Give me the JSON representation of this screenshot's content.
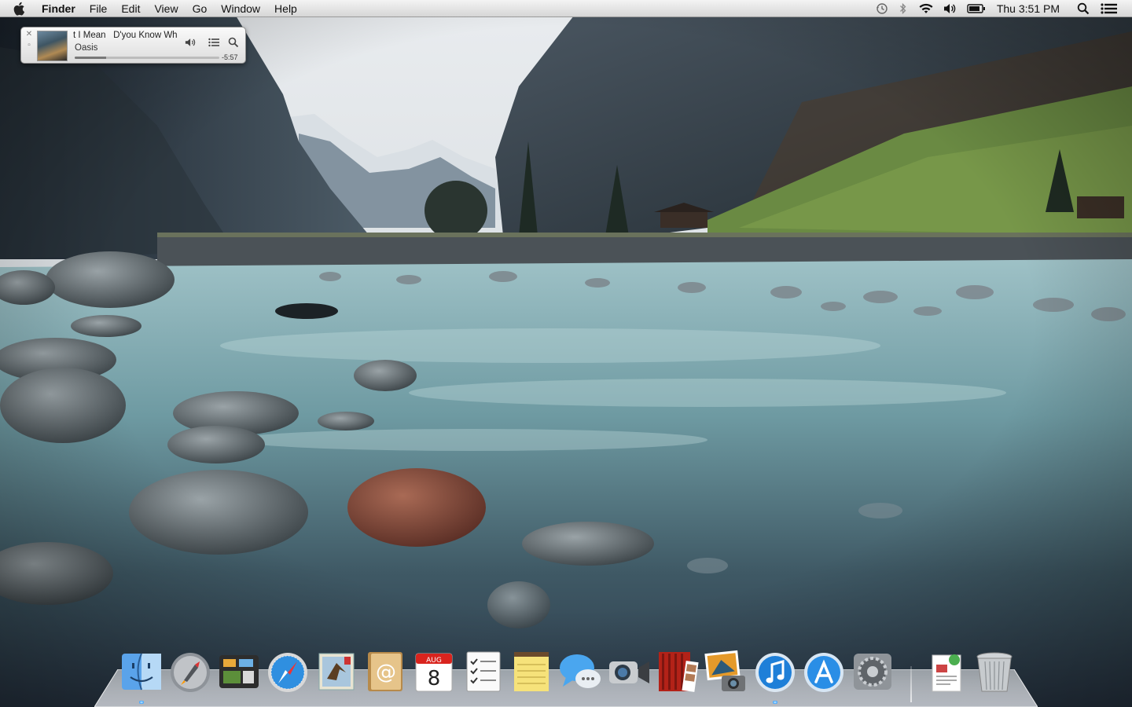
{
  "menubar": {
    "app_name": "Finder",
    "menus": [
      "File",
      "Edit",
      "View",
      "Go",
      "Window",
      "Help"
    ],
    "status_icons": [
      "time-machine-icon",
      "bluetooth-icon",
      "wifi-icon",
      "volume-icon",
      "battery-icon"
    ],
    "clock": "Thu 3:51 PM",
    "search_icon": "spotlight-icon",
    "list_icon": "notification-center-icon"
  },
  "miniplayer": {
    "track_title": "t I Mean   D'you Know Wh",
    "artist": "Oasis",
    "remaining": "-5:57",
    "progress": 0.22,
    "close_glyph": "✕",
    "shrink_glyph": "▫"
  },
  "dock": {
    "items": [
      {
        "name": "Finder",
        "icon": "finder-icon",
        "running": true
      },
      {
        "name": "Launchpad",
        "icon": "launchpad-icon",
        "running": false
      },
      {
        "name": "Mission Control",
        "icon": "mission-control-icon",
        "running": false
      },
      {
        "name": "Safari",
        "icon": "safari-icon",
        "running": false
      },
      {
        "name": "Mail",
        "icon": "mail-icon",
        "running": false
      },
      {
        "name": "Contacts",
        "icon": "contacts-icon",
        "running": false
      },
      {
        "name": "Calendar",
        "icon": "calendar-icon",
        "running": false,
        "month": "AUG",
        "day": "8"
      },
      {
        "name": "Reminders",
        "icon": "reminders-icon",
        "running": false
      },
      {
        "name": "Notes",
        "icon": "notes-icon",
        "running": false
      },
      {
        "name": "Messages",
        "icon": "messages-icon",
        "running": false
      },
      {
        "name": "FaceTime",
        "icon": "facetime-icon",
        "running": false
      },
      {
        "name": "Photo Booth",
        "icon": "photo-booth-icon",
        "running": false
      },
      {
        "name": "iPhoto",
        "icon": "iphoto-icon",
        "running": false
      },
      {
        "name": "iTunes",
        "icon": "itunes-icon",
        "running": true
      },
      {
        "name": "App Store",
        "icon": "app-store-icon",
        "running": false
      },
      {
        "name": "System Preferences",
        "icon": "system-preferences-icon",
        "running": false
      },
      {
        "name": "Documents",
        "icon": "documents-stack-icon",
        "running": false
      },
      {
        "name": "Trash",
        "icon": "trash-icon",
        "running": false
      }
    ]
  }
}
